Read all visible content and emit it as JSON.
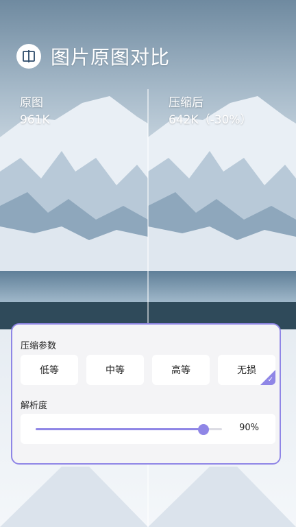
{
  "header": {
    "icon": "compare-icon",
    "title": "图片原图对比"
  },
  "original": {
    "label": "原图",
    "size": "961K"
  },
  "compressed": {
    "label": "压缩后",
    "size": "642K（-30%）"
  },
  "panel": {
    "compress_label": "压缩参数",
    "options": [
      {
        "label": "低等",
        "selected": false
      },
      {
        "label": "中等",
        "selected": false
      },
      {
        "label": "高等",
        "selected": false
      },
      {
        "label": "无损",
        "selected": true
      }
    ],
    "resolution_label": "解析度",
    "resolution_value": 0.9,
    "resolution_text": "90%"
  },
  "colors": {
    "accent": "#8f86e6",
    "panel_bg": "#f4f4f6"
  }
}
